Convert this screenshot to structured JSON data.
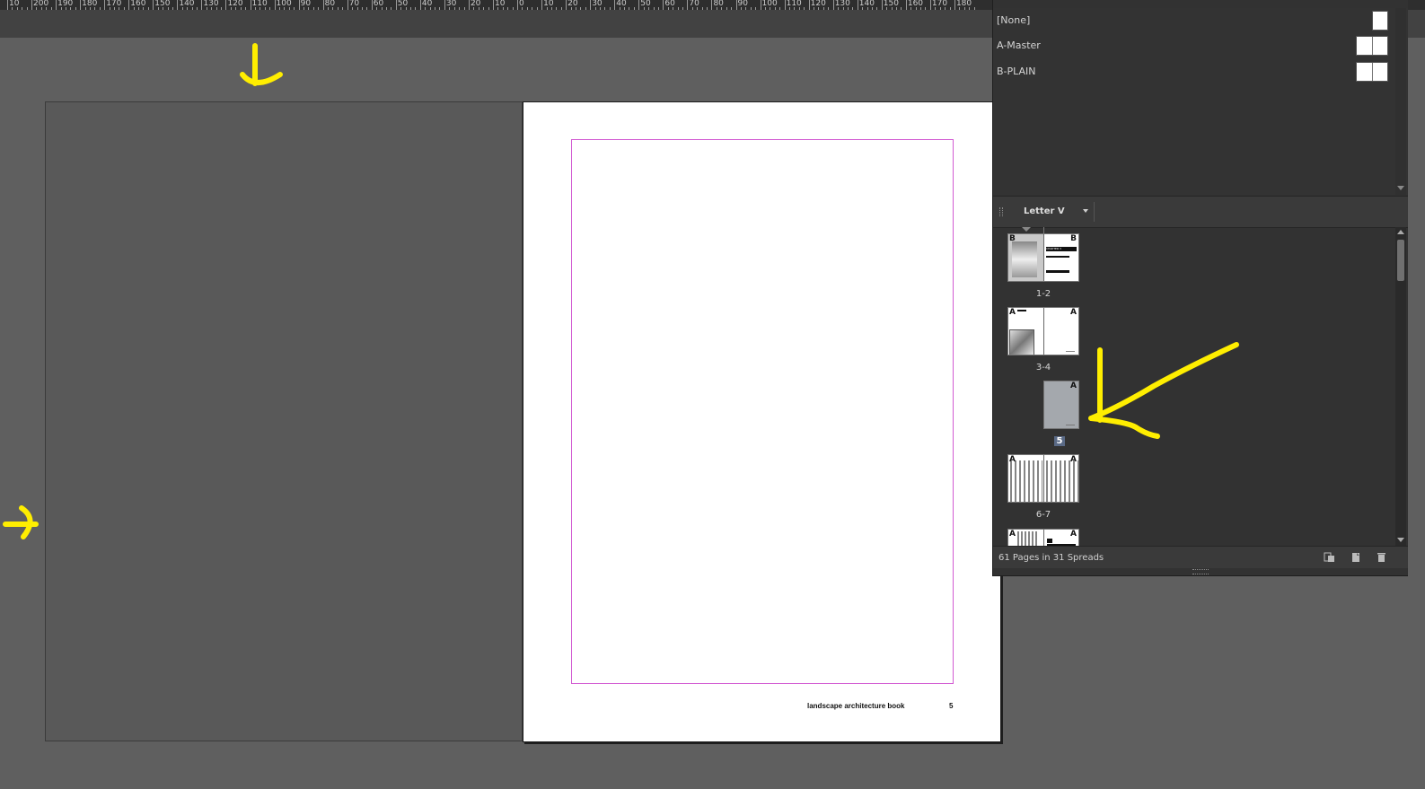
{
  "ruler": {
    "labels": [
      "10",
      "200",
      "190",
      "180",
      "170",
      "160",
      "150",
      "140",
      "130",
      "120",
      "110",
      "100",
      "90",
      "80",
      "70",
      "60",
      "50",
      "40",
      "30",
      "20",
      "10",
      "0",
      "10",
      "20",
      "30",
      "40",
      "50",
      "60",
      "70",
      "80",
      "90",
      "100",
      "110",
      "120",
      "130",
      "140",
      "150",
      "160",
      "170",
      "180"
    ]
  },
  "document": {
    "footer_title": "landscape architecture book",
    "footer_page_number": "5"
  },
  "pages_panel": {
    "masters": [
      {
        "label": "[None]",
        "thumb": "single"
      },
      {
        "label": "A-Master",
        "thumb": "double"
      },
      {
        "label": "B-PLAIN",
        "thumb": "double"
      }
    ],
    "page_size": "Letter V",
    "spreads": [
      {
        "label": "1-2",
        "left_prefix": "B",
        "right_prefix": "B",
        "selected": false
      },
      {
        "label": "3-4",
        "left_prefix": "A",
        "right_prefix": "A",
        "selected": false
      },
      {
        "label": "5",
        "left_prefix": "",
        "right_prefix": "A",
        "selected": true
      },
      {
        "label": "6-7",
        "left_prefix": "A",
        "right_prefix": "A",
        "selected": false
      },
      {
        "label": "",
        "left_prefix": "A",
        "right_prefix": "A",
        "selected": false
      }
    ],
    "chapter_text": "CHAPTER 3",
    "status": "61 Pages in 31 Spreads"
  },
  "colors": {
    "annotation": "#ffee00",
    "margin_guide": "#d25bd2",
    "selected_page": "#a4a8ad"
  },
  "icons": [
    "edit-page-size-icon",
    "new-page-icon",
    "delete-page-icon"
  ]
}
